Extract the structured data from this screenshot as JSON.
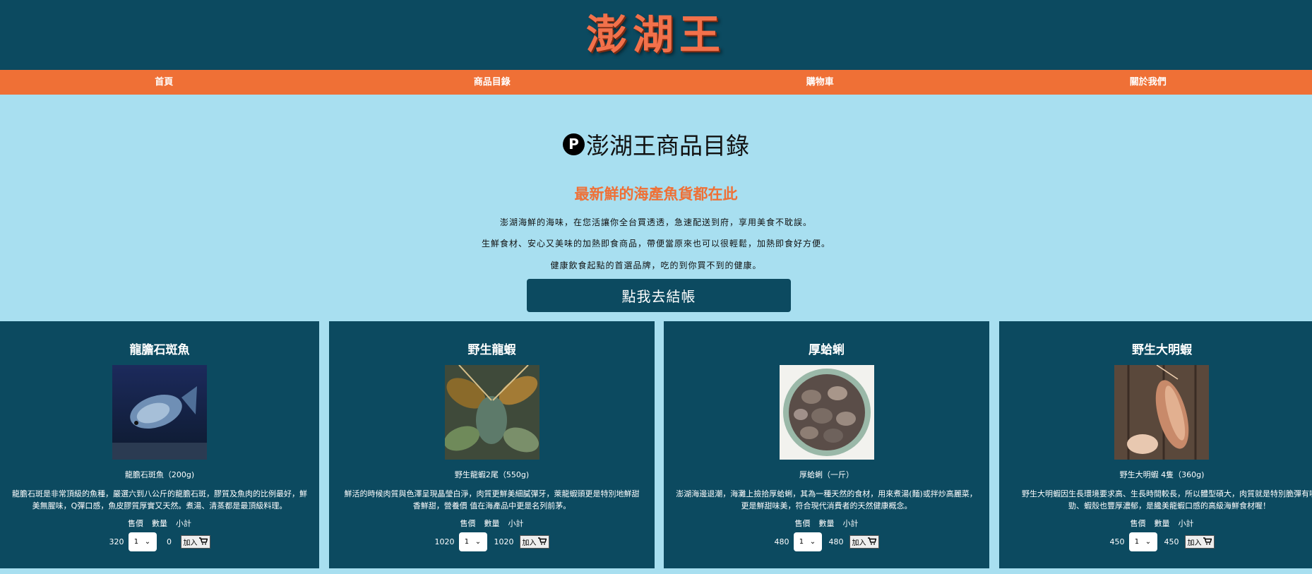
{
  "header": {
    "logo": "澎湖王"
  },
  "nav": {
    "items": [
      "首頁",
      "商品目錄",
      "購物車",
      "關於我們"
    ]
  },
  "catalog": {
    "icon": "P",
    "title": "澎湖王商品目錄",
    "subtitle": "最新鮮的海產魚貨都在此",
    "desc1": "澎湖海鮮的海味，在您活讓你全台買透透，急速配送到府，享用美食不耽誤。",
    "desc2": "生鮮食材、安心又美味的加熱即食商品，帶便當原來也可以很輕鬆，加熱即食好方便。",
    "desc3": "健康飲食起點的首選品牌，吃的到你買不到的健康。",
    "checkout_label": "點我去結帳"
  },
  "table_headers": {
    "price": "售價",
    "qty": "數量",
    "subtotal": "小計"
  },
  "add_label": "加入",
  "products": [
    {
      "name": "龍膽石斑魚",
      "sub": "龍膽石斑魚（200g)",
      "text": "龍膽石斑是非常頂級的魚種，嚴選六到八公斤的龍膽石斑，膠質及魚肉的比例最好，鮮\n美無腥味，Q彈口感，魚皮膠質厚實又天然。煮湯、清蒸都是最頂級料理。",
      "price": "320",
      "qty": "1",
      "subtotal": "0"
    },
    {
      "name": "野生龍蝦",
      "sub": "野生龍蝦2尾（550g)",
      "text": "鮮活的時候肉質與色澤呈現晶瑩白淨，肉質更鮮美細膩彈牙，萊龍蝦頭更是特別地鮮甜\n香鮮甜，營養價 值在海產品中更是名列前茅。",
      "price": "1020",
      "qty": "1",
      "subtotal": "1020"
    },
    {
      "name": "厚蛤蜊",
      "sub": "厚蛤蜊（一斤）",
      "text": "澎湖海邊退潮，海灘上撿拾厚蛤蜊，其為一種天然的食材，用來煮湯(麵)或拌炒高麗菜，\n更是鮮甜味美，符合現代消費者的天然健康概念。",
      "price": "480",
      "qty": "1",
      "subtotal": "480"
    },
    {
      "name": "野生大明蝦",
      "sub": "野生大明蝦 4隻（360g)",
      "text": "野生大明蝦因生長環境要求高、生長時間較長，所以體型碩大，肉質就是特別脆彈有嚼\n勁、蝦殼也豐厚濃郁，是饞美龍蝦口感的高級海鮮食材喔！",
      "price": "450",
      "qty": "1",
      "subtotal": "450"
    }
  ]
}
